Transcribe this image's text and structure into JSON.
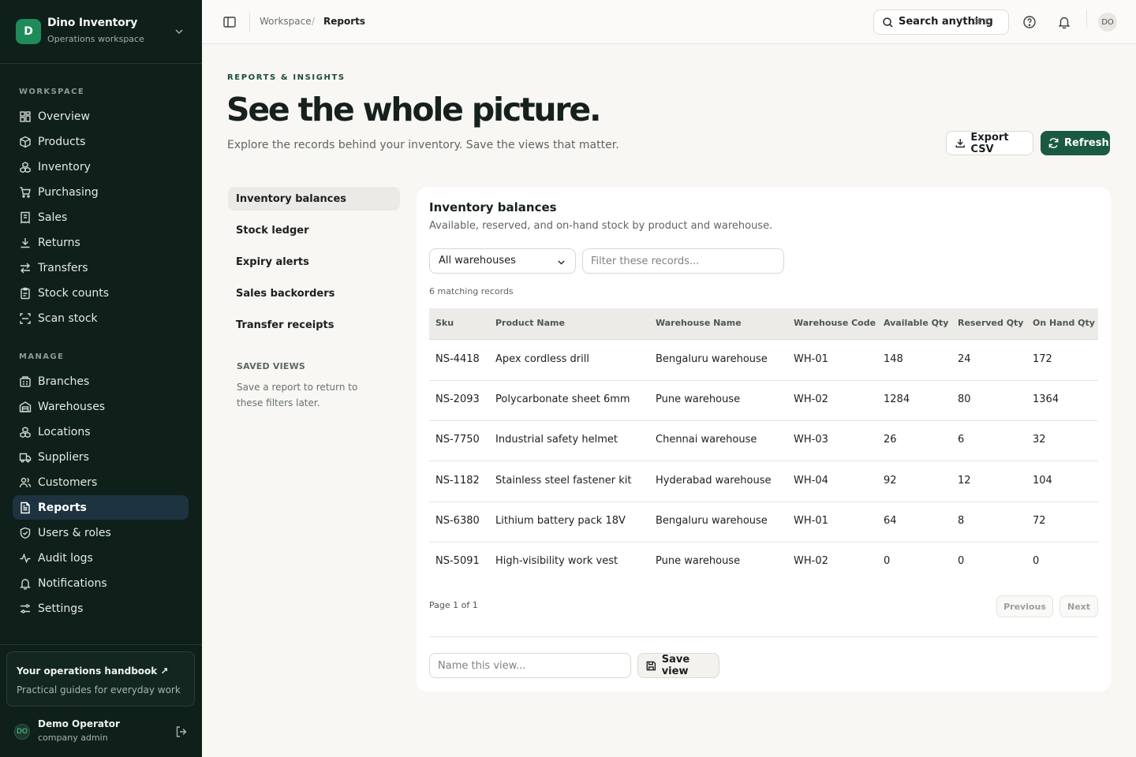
{
  "workspace": {
    "logo_letter": "D",
    "name": "Dino Inventory",
    "subtitle": "Operations workspace"
  },
  "sidebar": {
    "section_workspace": "WORKSPACE",
    "workspace_items": [
      {
        "label": "Overview",
        "icon": "grid-icon"
      },
      {
        "label": "Products",
        "icon": "box-icon"
      },
      {
        "label": "Inventory",
        "icon": "boxes-icon"
      },
      {
        "label": "Purchasing",
        "icon": "cart-icon"
      },
      {
        "label": "Sales",
        "icon": "receipt-icon"
      },
      {
        "label": "Returns",
        "icon": "download-icon"
      },
      {
        "label": "Transfers",
        "icon": "arrows-icon"
      },
      {
        "label": "Stock counts",
        "icon": "clipboard-icon"
      },
      {
        "label": "Scan stock",
        "icon": "scan-icon"
      }
    ],
    "section_manage": "MANAGE",
    "manage_items": [
      {
        "label": "Branches",
        "icon": "building-icon"
      },
      {
        "label": "Warehouses",
        "icon": "warehouse-icon"
      },
      {
        "label": "Locations",
        "icon": "boxes-icon"
      },
      {
        "label": "Suppliers",
        "icon": "truck-icon"
      },
      {
        "label": "Customers",
        "icon": "users-icon"
      },
      {
        "label": "Reports",
        "icon": "report-icon",
        "active": true
      },
      {
        "label": "Users & roles",
        "icon": "shield-icon"
      },
      {
        "label": "Audit logs",
        "icon": "activity-icon"
      },
      {
        "label": "Notifications",
        "icon": "bell-icon"
      },
      {
        "label": "Settings",
        "icon": "sliders-icon"
      }
    ],
    "handbook_title": "Your operations handbook ↗",
    "handbook_sub": "Practical guides for everyday work",
    "user_initials": "DO",
    "user_name": "Demo Operator",
    "user_role": "company admin"
  },
  "topbar": {
    "breadcrumb": [
      "Workspace",
      "Reports"
    ],
    "breadcrumb_sep": "/",
    "search_label": "Search anything",
    "search_shortcut": "⌘ K",
    "avatar_initials": "DO"
  },
  "header": {
    "eyebrow": "REPORTS & INSIGHTS",
    "title": "See the whole picture.",
    "subtitle": "Explore the records behind your inventory. Save the views that matter.",
    "export_label": "Export CSV",
    "refresh_label": "Refresh"
  },
  "report_nav": {
    "items": [
      "Inventory balances",
      "Stock ledger",
      "Expiry alerts",
      "Sales backorders",
      "Transfer receipts"
    ],
    "active_index": 0,
    "saved_views_heading": "SAVED VIEWS",
    "saved_views_text": "Save a report to return to these filters later."
  },
  "report": {
    "title": "Inventory balances",
    "description": "Available, reserved, and on-hand stock by product and warehouse.",
    "warehouse_filter": "All warehouses",
    "filter_placeholder": "Filter these records...",
    "match_count": "6 matching records",
    "columns": [
      "Sku",
      "Product Name",
      "Warehouse Name",
      "Warehouse Code",
      "Available Qty",
      "Reserved Qty",
      "On Hand Qty"
    ],
    "rows": [
      [
        "NS-4418",
        "Apex cordless drill",
        "Bengaluru warehouse",
        "WH-01",
        "148",
        "24",
        "172"
      ],
      [
        "NS-2093",
        "Polycarbonate sheet 6mm",
        "Pune warehouse",
        "WH-02",
        "1284",
        "80",
        "1364"
      ],
      [
        "NS-7750",
        "Industrial safety helmet",
        "Chennai warehouse",
        "WH-03",
        "26",
        "6",
        "32"
      ],
      [
        "NS-1182",
        "Stainless steel fastener kit",
        "Hyderabad warehouse",
        "WH-04",
        "92",
        "12",
        "104"
      ],
      [
        "NS-6380",
        "Lithium battery pack 18V",
        "Bengaluru warehouse",
        "WH-01",
        "64",
        "8",
        "72"
      ],
      [
        "NS-5091",
        "High-visibility work vest",
        "Pune warehouse",
        "WH-02",
        "0",
        "0",
        "0"
      ]
    ],
    "page_info": "Page 1 of 1",
    "prev_label": "Previous",
    "next_label": "Next",
    "view_name_placeholder": "Name this view...",
    "save_view_label": "Save view"
  },
  "colors": {
    "sidebar_bg": "#0f1f1a",
    "accent_green": "#1b5a42",
    "logo_green": "#1f8a5a",
    "active_nav_bg": "#1e3340",
    "page_bg": "#f8f7f4"
  }
}
